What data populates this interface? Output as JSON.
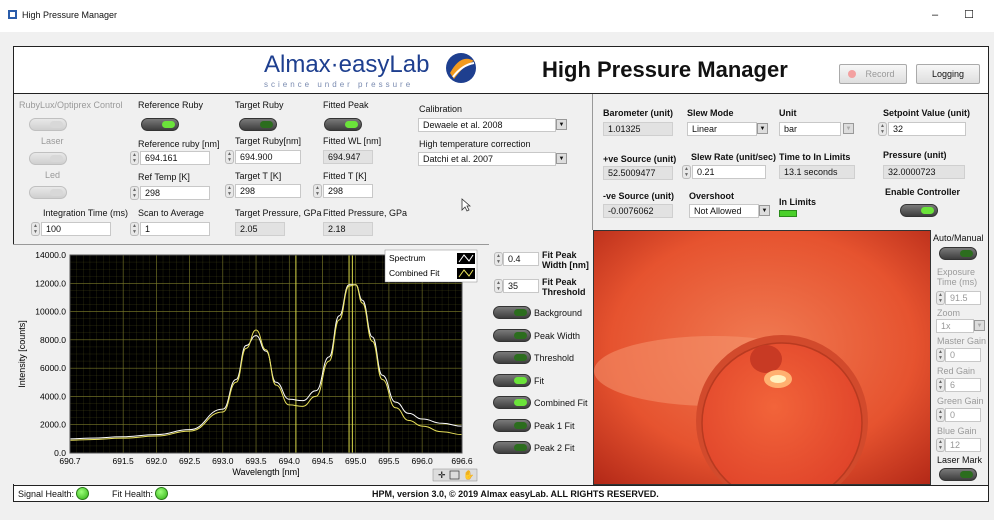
{
  "window": {
    "title": "High Pressure Manager",
    "minimize": "–",
    "maximize": "☐"
  },
  "header": {
    "logo_main": "Almax·easyLab",
    "logo_sub": "science under pressure",
    "app_title": "High Pressure Manager",
    "record_label": "Record",
    "logging_label": "Logging"
  },
  "left_controls": {
    "rubylux_label": "RubyLux/Optiprex Control",
    "laser_label": "Laser",
    "led_label": "Led",
    "integration_time_label": "Integration Time (ms)",
    "integration_time_value": "100",
    "reference_ruby_label": "Reference Ruby",
    "reference_ruby_nm_label": "Reference ruby [nm]",
    "reference_ruby_nm_value": "694.161",
    "ref_temp_label": "Ref Temp [K]",
    "ref_temp_value": "298",
    "scan_avg_label": "Scan to Average",
    "scan_avg_value": "1",
    "target_ruby_label": "Target Ruby",
    "target_ruby_nm_label": "Target Ruby[nm]",
    "target_ruby_nm_value": "694.900",
    "target_t_label": "Target T [K]",
    "target_t_value": "298",
    "target_pressure_label": "Target Pressure, GPa",
    "target_pressure_value": "2.05",
    "fitted_peak_label": "Fitted Peak",
    "fitted_wl_label": "Fitted WL [nm]",
    "fitted_wl_value": "694.947",
    "fitted_t_label": "Fitted T [K]",
    "fitted_t_value": "298",
    "fitted_pressure_label": "Fitted Pressure, GPa",
    "fitted_pressure_value": "2.18",
    "calibration_label": "Calibration",
    "calibration_value": "Dewaele et al. 2008",
    "high_temp_label": "High temperature correction",
    "high_temp_value": "Datchi et al. 2007"
  },
  "right_controls": {
    "barometer_label": "Barometer (unit)",
    "barometer_value": "1.01325",
    "slew_mode_label": "Slew Mode",
    "slew_mode_value": "Linear",
    "unit_label": "Unit",
    "unit_value": "bar",
    "setpoint_label": "Setpoint Value (unit)",
    "setpoint_value": "32",
    "pos_source_label": "+ve Source (unit)",
    "pos_source_value": "52.5009477",
    "slew_rate_label": "Slew Rate (unit/sec)",
    "slew_rate_value": "0.21",
    "time_limits_label": "Time to In Limits",
    "time_limits_value": "13.1 seconds",
    "pressure_label": "Pressure (unit)",
    "pressure_value": "32.0000723",
    "neg_source_label": "-ve Source (unit)",
    "neg_source_value": "-0.0076062",
    "overshoot_label": "Overshoot",
    "overshoot_value": "Not Allowed",
    "in_limits_label": "In Limits",
    "enable_controller_label": "Enable Controller"
  },
  "fit_panel": {
    "fit_peak_width_label": "Fit Peak Width [nm]",
    "fit_peak_width_value": "0.4",
    "fit_peak_threshold_label": "Fit Peak Threshold",
    "fit_peak_threshold_value": "35",
    "toggles": [
      "Background",
      "Peak Width",
      "Threshold",
      "Fit",
      "Combined Fit",
      "Peak 1 Fit",
      "Peak 2 Fit"
    ]
  },
  "camera_panel": {
    "auto_manual_label": "Auto/Manual",
    "exposure_label": "Exposure Time (ms)",
    "exposure_value": "91.5",
    "zoom_label": "Zoom",
    "zoom_value": "1x",
    "master_gain_label": "Master Gain",
    "master_gain_value": "0",
    "red_gain_label": "Red Gain",
    "red_gain_value": "6",
    "green_gain_label": "Green Gain",
    "green_gain_value": "0",
    "blue_gain_label": "Blue Gain",
    "blue_gain_value": "12",
    "laser_mark_label": "Laser Mark"
  },
  "status": {
    "signal_health_label": "Signal Health:",
    "fit_health_label": "Fit Health:",
    "copyright": "HPM, version 3.0, © 2019 Almax easyLab.  ALL RIGHTS RESERVED."
  },
  "colors": {
    "plot_bg": "#000000",
    "grid": "#7a7a2a",
    "spectrum": "#ffffff",
    "fit": "#e8e05a",
    "cursor": "#d8d84a",
    "camera": "#e3452a"
  },
  "chart_data": {
    "type": "line",
    "xlabel": "Wavelength [nm]",
    "ylabel": "Intensity [counts]",
    "xlim": [
      690.7,
      696.6
    ],
    "ylim": [
      0,
      14000
    ],
    "x_ticks": [
      "690.7",
      "691.5",
      "692.0",
      "692.5",
      "693.0",
      "693.5",
      "694.0",
      "694.5",
      "695.0",
      "695.5",
      "696.0",
      "696.6"
    ],
    "x_tick_values": [
      690.7,
      691.5,
      692.0,
      692.5,
      693.0,
      693.5,
      694.0,
      694.5,
      695.0,
      695.5,
      696.0,
      696.6
    ],
    "y_ticks": [
      "0.0",
      "2000.0",
      "4000.0",
      "6000.0",
      "8000.0",
      "10000.0",
      "12000.0",
      "14000.0"
    ],
    "y_tick_values": [
      0,
      2000,
      4000,
      6000,
      8000,
      10000,
      12000,
      14000
    ],
    "legend": [
      "Spectrum",
      "Combined Fit"
    ],
    "legend_position": "top-right",
    "grid": true,
    "cursors_x": [
      694.1,
      694.9,
      694.95
    ],
    "series": [
      {
        "name": "Spectrum",
        "x": [
          690.7,
          691.0,
          691.5,
          692.0,
          692.5,
          693.0,
          693.2,
          693.35,
          693.5,
          693.65,
          693.8,
          694.0,
          694.2,
          694.4,
          694.6,
          694.75,
          694.9,
          695.0,
          695.1,
          695.25,
          695.4,
          695.6,
          695.8,
          696.0,
          696.3,
          696.6
        ],
        "y": [
          1000,
          1050,
          1150,
          1300,
          1650,
          3100,
          5200,
          7600,
          8300,
          7200,
          5000,
          3800,
          3700,
          4400,
          6800,
          9700,
          11900,
          11900,
          10800,
          8200,
          5500,
          3600,
          2800,
          2400,
          2100,
          1900
        ]
      },
      {
        "name": "Combined Fit",
        "x": [
          690.7,
          691.0,
          691.5,
          692.0,
          692.5,
          693.0,
          693.2,
          693.35,
          693.5,
          693.65,
          693.8,
          694.0,
          694.2,
          694.4,
          694.6,
          694.75,
          694.9,
          695.0,
          695.1,
          695.25,
          695.4,
          695.6,
          695.8,
          696.0,
          696.3,
          696.6
        ],
        "y": [
          900,
          950,
          1050,
          1200,
          1550,
          2900,
          5000,
          7400,
          8700,
          7300,
          4800,
          3400,
          3300,
          4000,
          6500,
          9400,
          11800,
          11900,
          10600,
          7900,
          5200,
          3200,
          2300,
          1900,
          1500,
          1300
        ]
      }
    ]
  }
}
